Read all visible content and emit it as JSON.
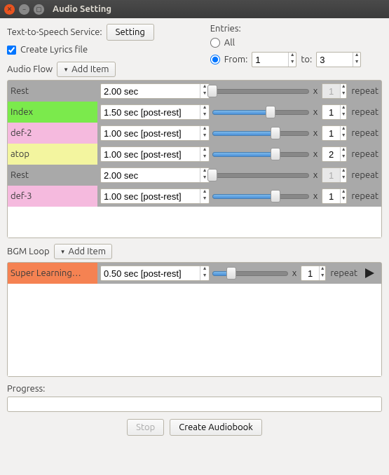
{
  "window": {
    "title": "Audio Setting"
  },
  "tts": {
    "label": "Text-to-Speech Service:",
    "button": "Setting"
  },
  "lyrics": {
    "label": "Create Lyrics file",
    "checked": true
  },
  "audio_flow": {
    "label": "Audio Flow",
    "add_item": "Add Item"
  },
  "entries": {
    "label": "Entries:",
    "all_label": "All",
    "from_label": "From:",
    "to_label": "to:",
    "selected": "from",
    "from_value": "1",
    "to_value": "3"
  },
  "flow_rows": [
    {
      "name": "Rest",
      "color": "rest",
      "duration": "2.00 sec",
      "fill": 0,
      "repeat": "1",
      "repeat_disabled": true
    },
    {
      "name": "Index",
      "color": "index",
      "duration": "1.50 sec [post-rest]",
      "fill": 60,
      "repeat": "1",
      "repeat_disabled": false
    },
    {
      "name": "def-2",
      "color": "def2",
      "duration": "1.00 sec [post-rest]",
      "fill": 65,
      "repeat": "1",
      "repeat_disabled": false
    },
    {
      "name": "atop",
      "color": "atop",
      "duration": "1.00 sec [post-rest]",
      "fill": 65,
      "repeat": "2",
      "repeat_disabled": false
    },
    {
      "name": "Rest",
      "color": "rest",
      "duration": "2.00 sec",
      "fill": 0,
      "repeat": "1",
      "repeat_disabled": true
    },
    {
      "name": "def-3",
      "color": "def3",
      "duration": "1.00 sec [post-rest]",
      "fill": 65,
      "repeat": "1",
      "repeat_disabled": false
    }
  ],
  "bgm": {
    "label": "BGM Loop",
    "add_item": "Add Item"
  },
  "bgm_rows": [
    {
      "name": "Super Learning…",
      "color": "super",
      "duration": "0.50 sec [post-rest]",
      "fill": 25,
      "repeat": "1",
      "repeat_disabled": false,
      "has_play": true
    }
  ],
  "repeat_label": "repeat",
  "x_label": "x",
  "progress": {
    "label": "Progress:"
  },
  "buttons": {
    "stop": "Stop",
    "create": "Create Audiobook"
  }
}
